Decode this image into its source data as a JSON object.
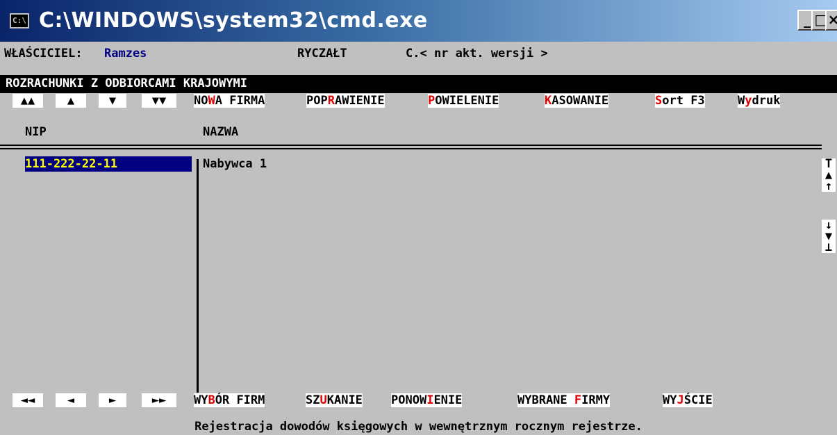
{
  "window": {
    "title": "C:\\WINDOWS\\system32\\cmd.exe",
    "icon_label": "C:\\",
    "min_glyph": "_",
    "max_glyph": "□",
    "close_glyph": "×"
  },
  "header": {
    "owner_label": "WŁAŚCICIEL:",
    "owner_value": "Ramzes",
    "tax_mode": "RYCZAŁT",
    "version_text": "C.< nr akt. wersji >"
  },
  "section": {
    "title": "ROZRACHUNKI Z ODBIORCAMI KRAJOWYMI"
  },
  "top_nav": {
    "keys": [
      "▲▲",
      "▲",
      "▼",
      "▼▼"
    ],
    "commands": [
      {
        "pre": "NO",
        "hot": "W",
        "post": "A FIRMA"
      },
      {
        "pre": "POP",
        "hot": "R",
        "post": "AWIENIE"
      },
      {
        "pre": "",
        "hot": "P",
        "post": "OWIELENIE"
      },
      {
        "pre": "",
        "hot": "K",
        "post": "ASOWANIE"
      },
      {
        "pre": "",
        "hot": "S",
        "post": "ort F3"
      },
      {
        "pre": "W",
        "hot": "y",
        "post": "druk"
      }
    ]
  },
  "table": {
    "columns": [
      "NIP",
      "NAZWA"
    ],
    "rows": [
      {
        "nip": "111-222-22-11",
        "nazwa": "Nabywca 1"
      }
    ]
  },
  "scroll": {
    "top": [
      "T",
      "▲",
      "↑"
    ],
    "bottom": [
      "↓",
      "▼",
      "⊥"
    ]
  },
  "bottom_nav": {
    "keys": [
      "◄◄",
      "◄",
      "►",
      "►►"
    ],
    "commands": [
      {
        "pre": "WY",
        "hot": "B",
        "post": "ÓR FIRM"
      },
      {
        "pre": "SZ",
        "hot": "U",
        "post": "KANIE"
      },
      {
        "pre": "PONOW",
        "hot": "I",
        "post": "ENIE"
      },
      {
        "pre": "WYBRANE ",
        "hot": "F",
        "post": "IRMY"
      },
      {
        "pre": "WY",
        "hot": "J",
        "post": "ŚCIE"
      }
    ]
  },
  "status": {
    "text": "Rejestracja dowodów księgowych w wewnętrznym rocznym rejestrze."
  },
  "colors": {
    "titlebar": "#0a246a",
    "console_bg": "#c0c0c0",
    "hotkey": "#e00000",
    "selection_bg": "#000080",
    "selection_fg": "#ffff00"
  }
}
